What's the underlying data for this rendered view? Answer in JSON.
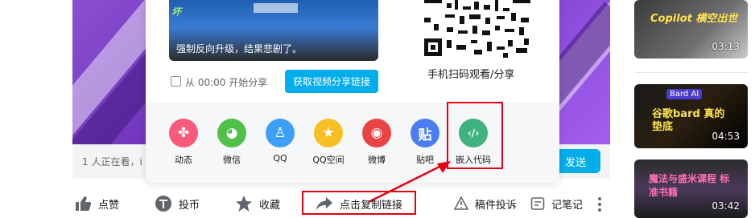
{
  "video": {
    "viewer_text": "1 人正在看，i",
    "send_label": "发送"
  },
  "share_panel": {
    "thumb_caption": "强制反向升级，结果悲剧了。",
    "thumb_logo": "坏",
    "start_checkbox_label": "从 00:00 开始分享",
    "get_link_button": "获取视频分享链接",
    "qr_label": "手机扫码观看/分享",
    "targets": [
      {
        "label": "动态",
        "icon": "pinwheel-icon",
        "color": "#f85a7b",
        "glyph": "✤"
      },
      {
        "label": "微信",
        "icon": "wechat-icon",
        "color": "#4fc04a",
        "glyph": "◕"
      },
      {
        "label": "QQ",
        "icon": "qq-icon",
        "color": "#3d9ff5",
        "glyph": "♙"
      },
      {
        "label": "QQ空间",
        "icon": "qzone-icon",
        "color": "#f6c025",
        "glyph": "★"
      },
      {
        "label": "微博",
        "icon": "weibo-icon",
        "color": "#ea4343",
        "glyph": "◉"
      },
      {
        "label": "贴吧",
        "icon": "tieba-icon",
        "color": "#4c7df0",
        "glyph": "贴"
      },
      {
        "label": "嵌入代码",
        "icon": "embed-code-icon",
        "color": "#3fb27f",
        "glyph": "‹/›"
      }
    ]
  },
  "toolbar": {
    "like": "点赞",
    "coin": "投币",
    "favorite": "收藏",
    "share": "点击复制链接",
    "report": "稿件投诉",
    "note": "记笔记"
  },
  "right": {
    "items": [
      {
        "title": "Copilot 横空出世",
        "duration": "03:13"
      },
      {
        "title": "谷歌bard 真的垫底",
        "duration": "04:53",
        "tag": "Bard AI"
      },
      {
        "title": "魔法与盛米课程 标准书籍",
        "duration": "03:42"
      }
    ]
  },
  "colors": {
    "accent": "#00aeec",
    "annotation_red": "#e60012"
  }
}
